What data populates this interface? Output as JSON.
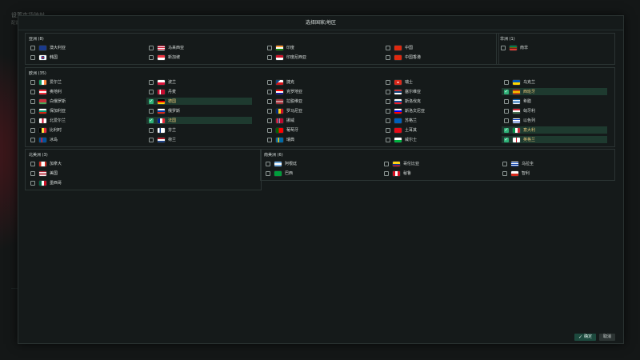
{
  "background": {
    "title": "设置市场映射",
    "subtitle": "配置..."
  },
  "dialog": {
    "title": "选择国家/地区",
    "confirm_label": "确定",
    "cancel_label": "取消"
  },
  "colors": {
    "selected_row": "#1e3a2f",
    "checkbox_on": "#2fb278",
    "confirm": "#1d4a3e"
  },
  "regions": {
    "asia": {
      "title": "亚洲 (8)",
      "items": [
        {
          "name": "澳大利亚",
          "flag": "au",
          "checked": false
        },
        {
          "name": "马来西亚",
          "flag": "my",
          "checked": false
        },
        {
          "name": "印度",
          "flag": "in",
          "checked": false
        },
        {
          "name": "中国",
          "flag": "cn",
          "checked": false
        },
        {
          "name": "韩国",
          "flag": "kr",
          "checked": false
        },
        {
          "name": "新加坡",
          "flag": "sg",
          "checked": false
        },
        {
          "name": "印度尼西亚",
          "flag": "id",
          "checked": false
        },
        {
          "name": "中国香港",
          "flag": "hk",
          "checked": false
        }
      ]
    },
    "africa": {
      "title": "非洲 (1)",
      "items": [
        {
          "name": "南非",
          "flag": "za",
          "checked": false
        }
      ]
    },
    "europe": {
      "title": "欧洲 (35)",
      "items": [
        {
          "name": "爱尔兰",
          "flag": "ie",
          "checked": false
        },
        {
          "name": "波兰",
          "flag": "pl",
          "checked": false
        },
        {
          "name": "捷克",
          "flag": "cz",
          "checked": false
        },
        {
          "name": "瑞士",
          "flag": "ch",
          "checked": false
        },
        {
          "name": "乌克兰",
          "flag": "ua",
          "checked": false
        },
        {
          "name": "奥地利",
          "flag": "at",
          "checked": false
        },
        {
          "name": "丹麦",
          "flag": "dk",
          "checked": false
        },
        {
          "name": "克罗地亚",
          "flag": "hr",
          "checked": false
        },
        {
          "name": "塞尔维亚",
          "flag": "rs",
          "checked": false
        },
        {
          "name": "西班牙",
          "flag": "es",
          "checked": true
        },
        {
          "name": "白俄罗斯",
          "flag": "by",
          "checked": false
        },
        {
          "name": "德国",
          "flag": "de",
          "checked": true
        },
        {
          "name": "拉脱维亚",
          "flag": "lv",
          "checked": false
        },
        {
          "name": "斯洛伐克",
          "flag": "sk",
          "checked": false
        },
        {
          "name": "希腊",
          "flag": "gr",
          "checked": false
        },
        {
          "name": "保加利亚",
          "flag": "bg",
          "checked": false
        },
        {
          "name": "俄罗斯",
          "flag": "ru",
          "checked": false
        },
        {
          "name": "罗马尼亚",
          "flag": "ro",
          "checked": false
        },
        {
          "name": "斯洛文尼亚",
          "flag": "si",
          "checked": false
        },
        {
          "name": "匈牙利",
          "flag": "hu",
          "checked": false
        },
        {
          "name": "北爱尔兰",
          "flag": "nir",
          "checked": false
        },
        {
          "name": "法国",
          "flag": "fr",
          "checked": true
        },
        {
          "name": "挪威",
          "flag": "no",
          "checked": false
        },
        {
          "name": "苏格兰",
          "flag": "sct",
          "checked": false
        },
        {
          "name": "以色列",
          "flag": "il",
          "checked": false
        },
        {
          "name": "比利时",
          "flag": "be",
          "checked": false
        },
        {
          "name": "芬兰",
          "flag": "fi",
          "checked": false
        },
        {
          "name": "葡萄牙",
          "flag": "pt",
          "checked": false
        },
        {
          "name": "土耳其",
          "flag": "tr",
          "checked": false
        },
        {
          "name": "意大利",
          "flag": "it",
          "checked": true
        },
        {
          "name": "冰岛",
          "flag": "is",
          "checked": false
        },
        {
          "name": "荷兰",
          "flag": "nl",
          "checked": false
        },
        {
          "name": "瑞典",
          "flag": "se",
          "checked": false
        },
        {
          "name": "威尔士",
          "flag": "wls",
          "checked": false
        },
        {
          "name": "英格兰",
          "flag": "eng",
          "checked": true
        }
      ]
    },
    "north_america": {
      "title": "北美洲 (3)",
      "items": [
        {
          "name": "加拿大",
          "flag": "ca",
          "checked": false
        },
        {
          "name": "美国",
          "flag": "us",
          "checked": false
        },
        {
          "name": "墨西哥",
          "flag": "mx",
          "checked": false
        }
      ]
    },
    "south_america": {
      "title": "南美洲 (6)",
      "items": [
        {
          "name": "阿根廷",
          "flag": "ar",
          "checked": false
        },
        {
          "name": "哥伦比亚",
          "flag": "co",
          "checked": false
        },
        {
          "name": "乌拉圭",
          "flag": "uy",
          "checked": false
        },
        {
          "name": "巴西",
          "flag": "br",
          "checked": false
        },
        {
          "name": "秘鲁",
          "flag": "pe",
          "checked": false
        },
        {
          "name": "智利",
          "flag": "cl",
          "checked": false
        }
      ]
    }
  }
}
